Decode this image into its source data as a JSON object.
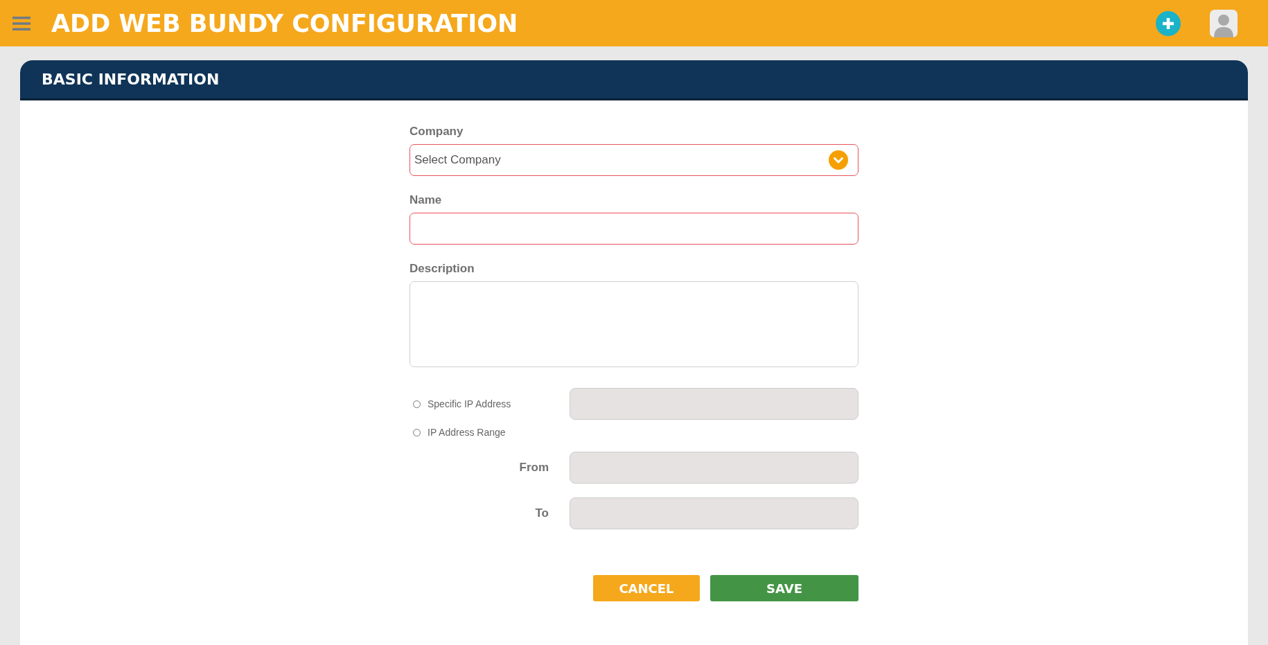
{
  "header": {
    "title": "ADD WEB BUNDY CONFIGURATION"
  },
  "panel": {
    "title": "BASIC INFORMATION"
  },
  "fields": [
    {
      "kind": "select",
      "label": "Company",
      "placeholder": "Select Company",
      "invalid": true
    },
    {
      "kind": "text",
      "label": "Name",
      "invalid": true
    },
    {
      "kind": "textarea",
      "label": "Description",
      "invalid": false
    }
  ],
  "ip_options": [
    {
      "kind": "single",
      "label": "Specific IP Address",
      "selected": false,
      "disabled": true
    },
    {
      "kind": "range",
      "label": "IP Address Range",
      "selected": false,
      "range_fields": [
        {
          "label": "From",
          "disabled": true
        },
        {
          "label": "To",
          "disabled": true
        }
      ]
    }
  ],
  "buttons": [
    {
      "kind": "cancel",
      "label": "CANCEL"
    },
    {
      "kind": "save",
      "label": "SAVE"
    }
  ]
}
